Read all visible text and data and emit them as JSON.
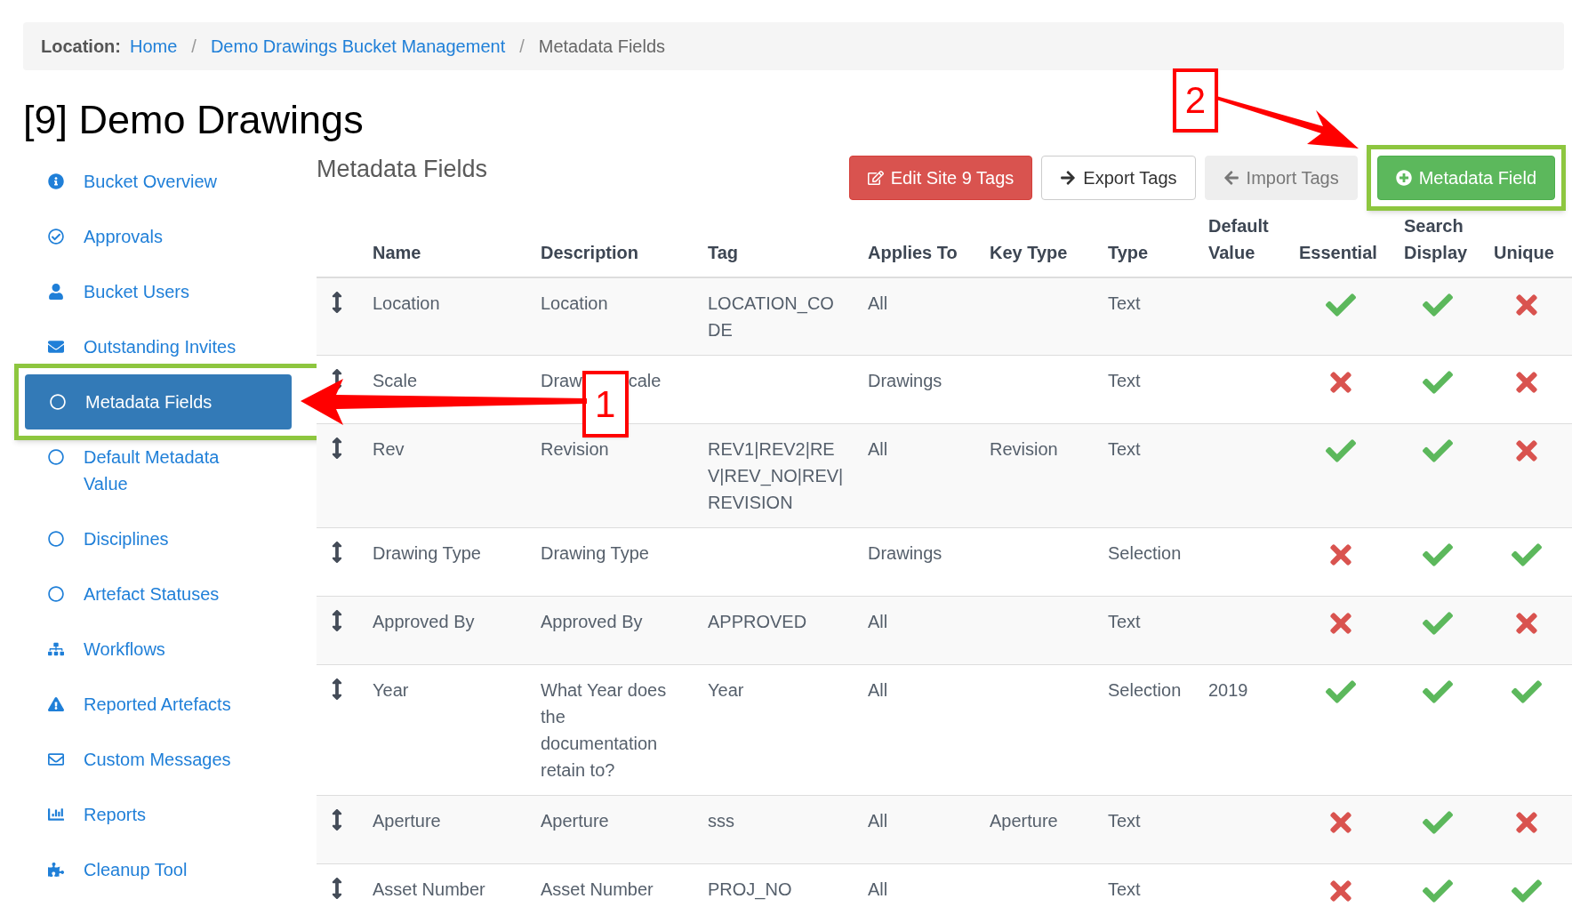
{
  "breadcrumb": {
    "label": "Location:",
    "links": [
      "Home",
      "Demo Drawings Bucket Management"
    ],
    "separator": "/",
    "current": "Metadata Fields"
  },
  "title": "[9] Demo Drawings",
  "sidebar": {
    "items": [
      {
        "label": "Bucket Overview",
        "selected": false,
        "highlighted": false
      },
      {
        "label": "Approvals",
        "selected": false,
        "highlighted": false
      },
      {
        "label": "Bucket Users",
        "selected": false,
        "highlighted": false
      },
      {
        "label": "Outstanding Invites",
        "selected": false,
        "highlighted": false
      },
      {
        "label": "Metadata Fields",
        "selected": true,
        "highlighted": true
      },
      {
        "label": "Default Metadata Value",
        "selected": false,
        "highlighted": false
      },
      {
        "label": "Disciplines",
        "selected": false,
        "highlighted": false
      },
      {
        "label": "Artefact Statuses",
        "selected": false,
        "highlighted": false
      },
      {
        "label": "Workflows",
        "selected": false,
        "highlighted": false
      },
      {
        "label": "Reported Artefacts",
        "selected": false,
        "highlighted": false
      },
      {
        "label": "Custom Messages",
        "selected": false,
        "highlighted": false
      },
      {
        "label": "Reports",
        "selected": false,
        "highlighted": false
      },
      {
        "label": "Cleanup Tool",
        "selected": false,
        "highlighted": false
      }
    ]
  },
  "section_title": "Metadata Fields",
  "buttons": [
    {
      "label": "Edit Site 9 Tags",
      "kind": "danger",
      "highlighted": false
    },
    {
      "label": "Export Tags",
      "kind": "default",
      "highlighted": false
    },
    {
      "label": "Import Tags",
      "kind": "muted",
      "highlighted": false
    },
    {
      "label": "Metadata Field",
      "kind": "success",
      "highlighted": true
    }
  ],
  "annotations": [
    {
      "label": "1"
    },
    {
      "label": "2"
    }
  ],
  "table": {
    "columns": [
      "Name",
      "Description",
      "Tag",
      "Applies To",
      "Key Type",
      "Type",
      "Default Value",
      "Essential",
      "Search Display",
      "Unique"
    ],
    "rows": [
      {
        "name": "Location",
        "description": [
          "Location"
        ],
        "tag": "LOCATION_CODE",
        "applies_to": "All",
        "key_type": "",
        "type": "Text",
        "default_value": "",
        "essential": true,
        "search_display": true,
        "unique": false
      },
      {
        "name": "Scale",
        "description": [
          "Draw",
          "cale"
        ],
        "tag": "",
        "applies_to": "Drawings",
        "key_type": "",
        "type": "Text",
        "default_value": "",
        "essential": false,
        "search_display": true,
        "unique": false
      },
      {
        "name": "Rev",
        "description": [
          "Revision"
        ],
        "tag": "REV1|REV2|REV|REV_NO|REV|REVISION",
        "applies_to": "All",
        "key_type": "Revision",
        "type": "Text",
        "default_value": "",
        "essential": true,
        "search_display": true,
        "unique": false
      },
      {
        "name": "Drawing Type",
        "description": [
          "Drawing Type"
        ],
        "tag": "",
        "applies_to": "Drawings",
        "key_type": "",
        "type": "Selection",
        "default_value": "",
        "essential": false,
        "search_display": true,
        "unique": true
      },
      {
        "name": "Approved By",
        "description": [
          "Approved By"
        ],
        "tag": "APPROVED",
        "applies_to": "All",
        "key_type": "",
        "type": "Text",
        "default_value": "",
        "essential": false,
        "search_display": true,
        "unique": false
      },
      {
        "name": "Year",
        "description": [
          "What Year does the documentation retain to?"
        ],
        "tag": "Year",
        "applies_to": "All",
        "key_type": "",
        "type": "Selection",
        "default_value": "2019",
        "essential": true,
        "search_display": true,
        "unique": true
      },
      {
        "name": "Aperture",
        "description": [
          "Aperture"
        ],
        "tag": "sss",
        "applies_to": "All",
        "key_type": "Aperture",
        "type": "Text",
        "default_value": "",
        "essential": false,
        "search_display": true,
        "unique": false
      },
      {
        "name": "Asset Number",
        "description": [
          "Asset Number"
        ],
        "tag": "PROJ_NO",
        "applies_to": "All",
        "key_type": "",
        "type": "Text",
        "default_value": "",
        "essential": false,
        "search_display": true,
        "unique": true
      }
    ]
  }
}
